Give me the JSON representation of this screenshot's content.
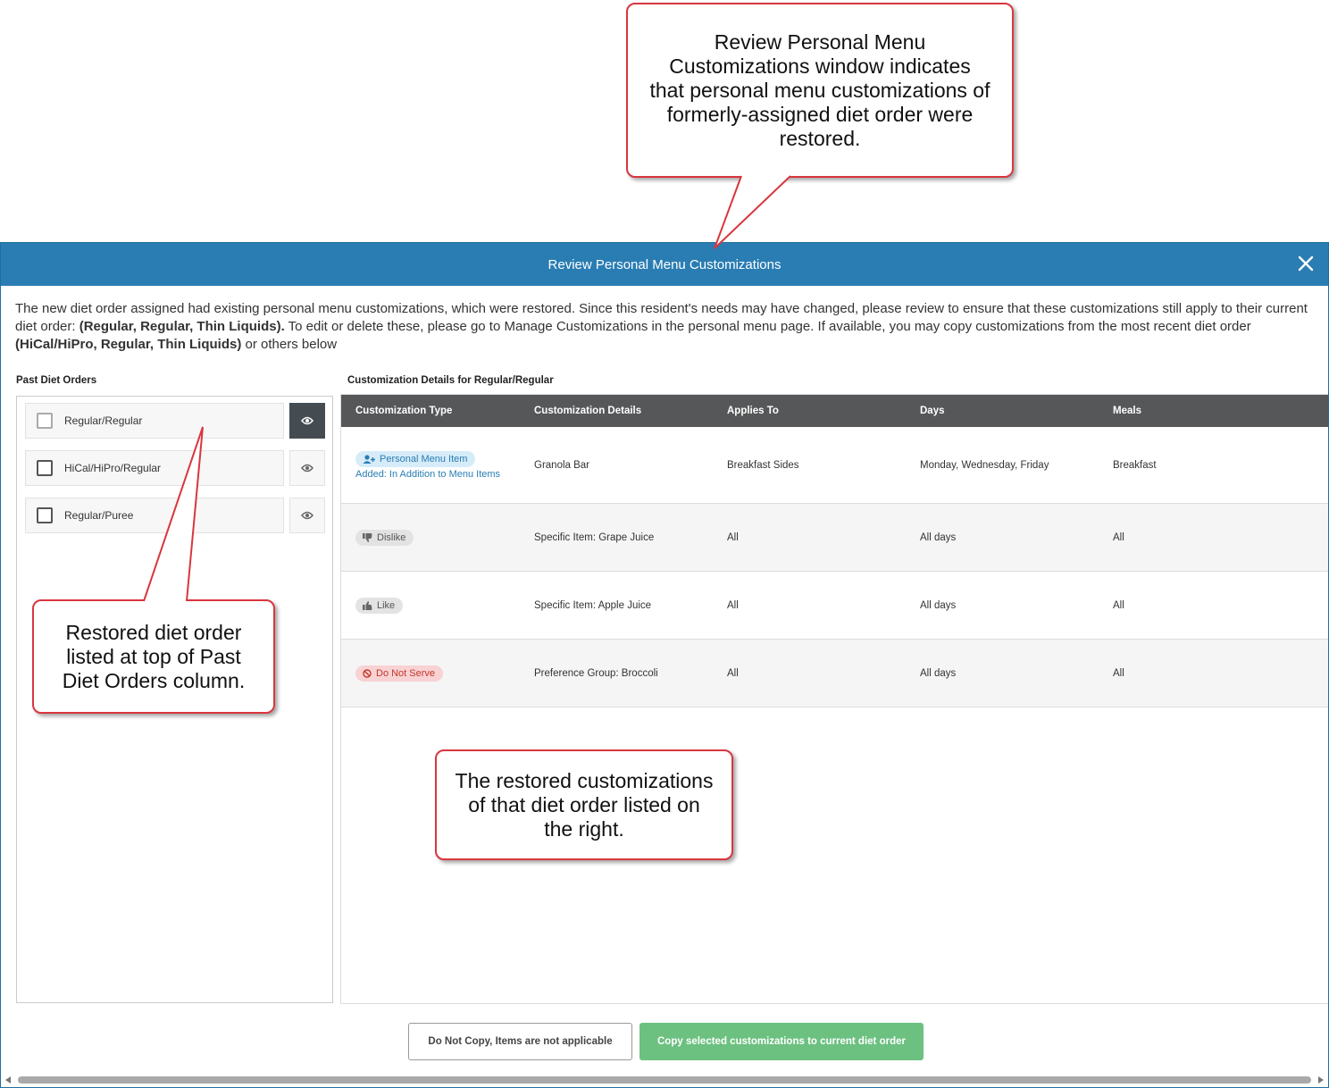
{
  "modal": {
    "title": "Review Personal Menu Customizations",
    "intro_1": "The new diet order assigned had existing personal menu customizations, which were restored. Since this resident's needs may have changed, please review to ensure that these customizations still apply to their current diet order: ",
    "intro_current": "(Regular, Regular, Thin Liquids).",
    "intro_2": " To edit or delete these, please go to Manage Customizations in the personal menu page. If available, you may copy customizations from the most recent diet order ",
    "intro_recent": "(HiCal/HiPro, Regular, Thin Liquids)",
    "intro_3": " or others below"
  },
  "past_orders": {
    "title": "Past Diet Orders",
    "items": [
      {
        "label": "Regular/Regular",
        "checked": false,
        "viewing": true
      },
      {
        "label": "HiCal/HiPro/Regular",
        "checked": false,
        "viewing": false
      },
      {
        "label": "Regular/Puree",
        "checked": false,
        "viewing": false
      }
    ]
  },
  "details": {
    "title": "Customization Details for Regular/Regular",
    "columns": [
      "Customization Type",
      "Customization Details",
      "Applies To",
      "Days",
      "Meals"
    ],
    "rows": [
      {
        "type": "Personal Menu Item",
        "type_style": "blue",
        "type_icon": "user-plus-icon",
        "note": "Added: In Addition to Menu Items",
        "details": "Granola Bar",
        "applies_to": "Breakfast Sides",
        "days": "Monday, Wednesday, Friday",
        "meals": "Breakfast"
      },
      {
        "type": "Dislike",
        "type_style": "gray",
        "type_icon": "thumbs-down-icon",
        "note": "",
        "details": "Specific Item: Grape Juice",
        "applies_to": "All",
        "days": "All days",
        "meals": "All"
      },
      {
        "type": "Like",
        "type_style": "gray",
        "type_icon": "thumbs-up-icon",
        "note": "",
        "details": "Specific Item: Apple Juice",
        "applies_to": "All",
        "days": "All days",
        "meals": "All"
      },
      {
        "type": "Do Not Serve",
        "type_style": "red",
        "type_icon": "ban-icon",
        "note": "",
        "details": "Preference Group: Broccoli",
        "applies_to": "All",
        "days": "All days",
        "meals": "All"
      }
    ]
  },
  "buttons": {
    "do_not_copy": "Do Not Copy, Items are not applicable",
    "copy_selected": "Copy selected customizations to current diet order"
  },
  "callouts": {
    "top": "Review Personal Menu Customizations window indicates that personal menu customizations of formerly-assigned diet order were restored.",
    "left": "Restored diet order listed at top of Past Diet Orders column.",
    "bottom": "The restored customizations of that diet order listed on the right."
  },
  "colors": {
    "header_blue": "#2a7db3",
    "table_header": "#555758",
    "primary_green": "#6cc080",
    "callout_red": "#d9363e"
  }
}
